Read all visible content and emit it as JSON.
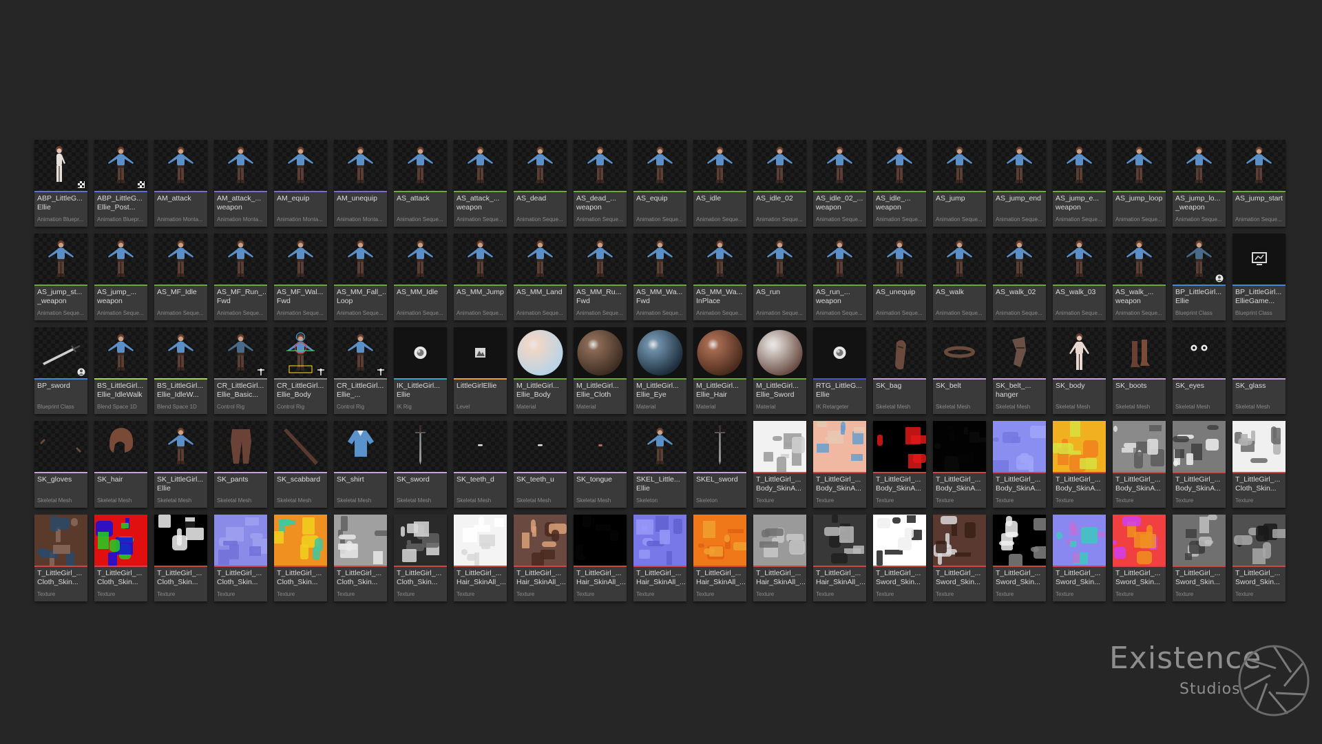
{
  "logo": {
    "main": "Existence",
    "sub": "Studios"
  },
  "colors": {
    "anim": "#5b6fd6",
    "montage": "#7f6ac9",
    "sequence": "#6fa840",
    "blueprint": "#4a86d9",
    "blendspace": "#a7d650",
    "controlrig": "#8c8c8c",
    "ikrig": "#3aa8c0",
    "level": "#e0a63a",
    "material": "#6fa840",
    "retarget": "#4a57c8",
    "mesh": "#c7a5d8",
    "skeleton": "#c7a5d8",
    "texture": "#d04646"
  },
  "assets": [
    {
      "name": "ABP_LittleG...\nEllie",
      "type": "Animation Bluepr...",
      "kind": "anim",
      "thumb": "char-pose",
      "badge": "flag-icon"
    },
    {
      "name": "ABP_LittleG...\nEllie_Post...",
      "type": "Animation Bluepr...",
      "kind": "anim",
      "thumb": "char",
      "badge": "flag-icon"
    },
    {
      "name": "AM_attack",
      "type": "Animation Monta...",
      "kind": "montage",
      "thumb": "char"
    },
    {
      "name": "AM_attack_...\nweapon",
      "type": "Animation Monta...",
      "kind": "montage",
      "thumb": "char"
    },
    {
      "name": "AM_equip",
      "type": "Animation Monta...",
      "kind": "montage",
      "thumb": "char"
    },
    {
      "name": "AM_unequip",
      "type": "Animation Monta...",
      "kind": "montage",
      "thumb": "char"
    },
    {
      "name": "AS_attack",
      "type": "Animation Seque...",
      "kind": "sequence",
      "thumb": "char"
    },
    {
      "name": "AS_attack_...\nweapon",
      "type": "Animation Seque...",
      "kind": "sequence",
      "thumb": "char"
    },
    {
      "name": "AS_dead",
      "type": "Animation Seque...",
      "kind": "sequence",
      "thumb": "char"
    },
    {
      "name": "AS_dead_...\nweapon",
      "type": "Animation Seque...",
      "kind": "sequence",
      "thumb": "char"
    },
    {
      "name": "AS_equip",
      "type": "Animation Seque...",
      "kind": "sequence",
      "thumb": "char"
    },
    {
      "name": "AS_idle",
      "type": "Animation Seque...",
      "kind": "sequence",
      "thumb": "char"
    },
    {
      "name": "AS_idle_02",
      "type": "Animation Seque...",
      "kind": "sequence",
      "thumb": "char"
    },
    {
      "name": "AS_idle_02_...\nweapon",
      "type": "Animation Seque...",
      "kind": "sequence",
      "thumb": "char"
    },
    {
      "name": "AS_idle_...\nweapon",
      "type": "Animation Seque...",
      "kind": "sequence",
      "thumb": "char"
    },
    {
      "name": "AS_jump",
      "type": "Animation Seque...",
      "kind": "sequence",
      "thumb": "char"
    },
    {
      "name": "AS_jump_end",
      "type": "Animation Seque...",
      "kind": "sequence",
      "thumb": "char"
    },
    {
      "name": "AS_jump_e...\nweapon",
      "type": "Animation Seque...",
      "kind": "sequence",
      "thumb": "char"
    },
    {
      "name": "AS_jump_loop",
      "type": "Animation Seque...",
      "kind": "sequence",
      "thumb": "char"
    },
    {
      "name": "AS_jump_lo...\n_weapon",
      "type": "Animation Seque...",
      "kind": "sequence",
      "thumb": "char"
    },
    {
      "name": "AS_jump_start",
      "type": "Animation Seque...",
      "kind": "sequence",
      "thumb": "char"
    },
    {
      "name": "AS_jump_st...\n_weapon",
      "type": "Animation Seque...",
      "kind": "sequence",
      "thumb": "char"
    },
    {
      "name": "AS_jump_...\nweapon",
      "type": "Animation Seque...",
      "kind": "sequence",
      "thumb": "char"
    },
    {
      "name": "AS_MF_Idle",
      "type": "Animation Seque...",
      "kind": "sequence",
      "thumb": "char"
    },
    {
      "name": "AS_MF_Run_...\nFwd",
      "type": "Animation Seque...",
      "kind": "sequence",
      "thumb": "char"
    },
    {
      "name": "AS_MF_Wal...\nFwd",
      "type": "Animation Seque...",
      "kind": "sequence",
      "thumb": "char"
    },
    {
      "name": "AS_MM_Fall_...\nLoop",
      "type": "Animation Seque...",
      "kind": "sequence",
      "thumb": "char"
    },
    {
      "name": "AS_MM_Idle",
      "type": "Animation Seque...",
      "kind": "sequence",
      "thumb": "char"
    },
    {
      "name": "AS_MM_Jump",
      "type": "Animation Seque...",
      "kind": "sequence",
      "thumb": "char"
    },
    {
      "name": "AS_MM_Land",
      "type": "Animation Seque...",
      "kind": "sequence",
      "thumb": "char"
    },
    {
      "name": "AS_MM_Ru...\nFwd",
      "type": "Animation Seque...",
      "kind": "sequence",
      "thumb": "char"
    },
    {
      "name": "AS_MM_Wa...\nFwd",
      "type": "Animation Seque...",
      "kind": "sequence",
      "thumb": "char"
    },
    {
      "name": "AS_MM_Wa...\nInPlace",
      "type": "Animation Seque...",
      "kind": "sequence",
      "thumb": "char"
    },
    {
      "name": "AS_run",
      "type": "Animation Seque...",
      "kind": "sequence",
      "thumb": "char"
    },
    {
      "name": "AS_run_...\nweapon",
      "type": "Animation Seque...",
      "kind": "sequence",
      "thumb": "char"
    },
    {
      "name": "AS_unequip",
      "type": "Animation Seque...",
      "kind": "sequence",
      "thumb": "char"
    },
    {
      "name": "AS_walk",
      "type": "Animation Seque...",
      "kind": "sequence",
      "thumb": "char"
    },
    {
      "name": "AS_walk_02",
      "type": "Animation Seque...",
      "kind": "sequence",
      "thumb": "char"
    },
    {
      "name": "AS_walk_03",
      "type": "Animation Seque...",
      "kind": "sequence",
      "thumb": "char"
    },
    {
      "name": "AS_walk_...\nweapon",
      "type": "Animation Seque...",
      "kind": "sequence",
      "thumb": "char"
    },
    {
      "name": "BP_LittleGirl...\nEllie",
      "type": "Blueprint Class",
      "kind": "blueprint",
      "thumb": "char-dark",
      "badge": "person-icon"
    },
    {
      "name": "BP_LittleGirl...\nEllieGame...",
      "type": "Blueprint Class",
      "kind": "blueprint",
      "thumb": "monitor-icon"
    },
    {
      "name": "BP_sword",
      "type": "Blueprint Class",
      "kind": "blueprint",
      "thumb": "sword-diag",
      "badge": "person-icon"
    },
    {
      "name": "BS_LittleGirl...\nEllie_IdleWalk",
      "type": "Blend Space 1D",
      "kind": "blendspace",
      "thumb": "char"
    },
    {
      "name": "BS_LittleGirl...\nEllie_IdleW...",
      "type": "Blend Space 1D",
      "kind": "blendspace",
      "thumb": "char"
    },
    {
      "name": "CR_LittleGirl...\nEllie_Basic...",
      "type": "Control Rig",
      "kind": "controlrig",
      "thumb": "char-dark",
      "badge": "rig-icon"
    },
    {
      "name": "CR_LittleGirl...\nEllie_Body",
      "type": "Control Rig",
      "kind": "controlrig",
      "thumb": "char-rig",
      "badge": "rig-icon"
    },
    {
      "name": "CR_LittleGirl...\nEllie_...",
      "type": "Control Rig",
      "kind": "controlrig",
      "thumb": "char",
      "badge": "rig-icon"
    },
    {
      "name": "IK_LittleGirl...\nEllie",
      "type": "IK Rig",
      "kind": "ikrig",
      "thumb": "rig-sphere-icon"
    },
    {
      "name": "LittleGirlEllie",
      "type": "Level",
      "kind": "level",
      "thumb": "level-icon"
    },
    {
      "name": "M_LittleGirl...\nEllie_Body",
      "type": "Material",
      "kind": "material",
      "thumb": "sphere:#efd6c8:#b8d4e6"
    },
    {
      "name": "M_LittleGirl...\nEllie_Cloth",
      "type": "Material",
      "kind": "material",
      "thumb": "sphere:#8a6a55:#3d2c22"
    },
    {
      "name": "M_LittleGirl...\nEllie_Eye",
      "type": "Material",
      "kind": "material",
      "thumb": "sphere:#6f8fa8:#1c2d3c"
    },
    {
      "name": "M_LittleGirl...\nEllie_Hair",
      "type": "Material",
      "kind": "material",
      "thumb": "sphere:#a56a50:#4a2a1c"
    },
    {
      "name": "M_LittleGirl...\nEllie_Sword",
      "type": "Material",
      "kind": "material",
      "thumb": "sphere:#d8d0cc:#6a4d44"
    },
    {
      "name": "RTG_LittleG...\nEllie",
      "type": "IK Retargeter",
      "kind": "retarget",
      "thumb": "rig-sphere-icon"
    },
    {
      "name": "SK_bag",
      "type": "Skeletal Mesh",
      "kind": "mesh",
      "thumb": "bag"
    },
    {
      "name": "SK_belt",
      "type": "Skeletal Mesh",
      "kind": "mesh",
      "thumb": "belt"
    },
    {
      "name": "SK_belt_...\nhanger",
      "type": "Skeletal Mesh",
      "kind": "mesh",
      "thumb": "hanger"
    },
    {
      "name": "SK_body",
      "type": "Skeletal Mesh",
      "kind": "mesh",
      "thumb": "body"
    },
    {
      "name": "SK_boots",
      "type": "Skeletal Mesh",
      "kind": "mesh",
      "thumb": "boots"
    },
    {
      "name": "SK_eyes",
      "type": "Skeletal Mesh",
      "kind": "mesh",
      "thumb": "eyes"
    },
    {
      "name": "SK_glass",
      "type": "Skeletal Mesh",
      "kind": "mesh",
      "thumb": "empty"
    },
    {
      "name": "SK_gloves",
      "type": "Skeletal Mesh",
      "kind": "mesh",
      "thumb": "gloves"
    },
    {
      "name": "SK_hair",
      "type": "Skeletal Mesh",
      "kind": "mesh",
      "thumb": "hair"
    },
    {
      "name": "SK_LittleGirl...\nEllie",
      "type": "Skeletal Mesh",
      "kind": "mesh",
      "thumb": "char"
    },
    {
      "name": "SK_pants",
      "type": "Skeletal Mesh",
      "kind": "mesh",
      "thumb": "pants"
    },
    {
      "name": "SK_scabbard",
      "type": "Skeletal Mesh",
      "kind": "mesh",
      "thumb": "scabbard"
    },
    {
      "name": "SK_shirt",
      "type": "Skeletal Mesh",
      "kind": "mesh",
      "thumb": "shirt"
    },
    {
      "name": "SK_sword",
      "type": "Skeletal Mesh",
      "kind": "mesh",
      "thumb": "sword-v"
    },
    {
      "name": "SK_teeth_d",
      "type": "Skeletal Mesh",
      "kind": "mesh",
      "thumb": "teeth"
    },
    {
      "name": "SK_teeth_u",
      "type": "Skeletal Mesh",
      "kind": "mesh",
      "thumb": "teeth"
    },
    {
      "name": "SK_tongue",
      "type": "Skeletal Mesh",
      "kind": "mesh",
      "thumb": "tongue"
    },
    {
      "name": "SKEL_Little...\nEllie",
      "type": "Skeleton",
      "kind": "skeleton",
      "thumb": "char"
    },
    {
      "name": "SKEL_sword",
      "type": "Skeleton",
      "kind": "skeleton",
      "thumb": "sword-v"
    },
    {
      "name": "T_LittleGirl_...\nBody_SkinA...",
      "type": "Texture",
      "kind": "texture",
      "thumb": "tex:#f2f2f2:#9a9a9a:#d0d0d0"
    },
    {
      "name": "T_LittleGirl_...\nBody_SkinA...",
      "type": "Texture",
      "kind": "texture",
      "thumb": "tex:#f0b8a0:#6a9ccc:#e8c8b4"
    },
    {
      "name": "T_LittleGirl_...\nBody_SkinA...",
      "type": "Texture",
      "kind": "texture",
      "thumb": "tex:#000000:#e01818:#000000"
    },
    {
      "name": "T_LittleGirl_...\nBody_SkinA...",
      "type": "Texture",
      "kind": "texture",
      "thumb": "tex:#020202:#0a0a0a:#050505"
    },
    {
      "name": "T_LittleGirl_...\nBody_SkinA...",
      "type": "Texture",
      "kind": "texture",
      "thumb": "tex:#8a8ef0:#7478e0:#a0a4f8"
    },
    {
      "name": "T_LittleGirl_...\nBody_SkinA...",
      "type": "Texture",
      "kind": "texture",
      "thumb": "tex:#f0b020:#d8e040:#f08020"
    },
    {
      "name": "T_LittleGirl_...\nBody_SkinA...",
      "type": "Texture",
      "kind": "texture",
      "thumb": "tex:#8a8a8a:#e0e0e0:#5a5a5a"
    },
    {
      "name": "T_LittleGirl_...\nBody_SkinA...",
      "type": "Texture",
      "kind": "texture",
      "thumb": "tex:#7a7a7a:#f0f0f0:#404040"
    },
    {
      "name": "T_LittleGirl_...\nCloth_Skin...",
      "type": "Texture",
      "kind": "texture",
      "thumb": "tex:#f0f0f0:#6a6a6a:#b0b0b0"
    },
    {
      "name": "T_LittleGirl_...\nCloth_Skin...",
      "type": "Texture",
      "kind": "texture",
      "thumb": "tex:#5a3a2a:#2a4a6a:#8a6a5a"
    },
    {
      "name": "T_LittleGirl_...\nCloth_Skin...",
      "type": "Texture",
      "kind": "texture",
      "thumb": "tex:#e01010:#20d020:#1010e0"
    },
    {
      "name": "T_LittleGirl_...\nCloth_Skin...",
      "type": "Texture",
      "kind": "texture",
      "thumb": "tex:#000000:#f0f0f0:#000000"
    },
    {
      "name": "T_LittleGirl_...\nCloth_Skin...",
      "type": "Texture",
      "kind": "texture",
      "thumb": "tex:#8a8ae8:#a0a0f0:#7070d8"
    },
    {
      "name": "T_LittleGirl_...\nCloth_Skin...",
      "type": "Texture",
      "kind": "texture",
      "thumb": "tex:#f09020:#40c8a0:#f0d020"
    },
    {
      "name": "T_LittleGirl_...\nCloth_Skin...",
      "type": "Texture",
      "kind": "texture",
      "thumb": "tex:#a0a0a0:#e8e8e8:#606060"
    },
    {
      "name": "T_LittleGirl_...\nCloth_Skin...",
      "type": "Texture",
      "kind": "texture",
      "thumb": "tex:#2a2a2a:#d8d8d8:#606060"
    },
    {
      "name": "T_LittleGirl_...\nHair_SkinAll_...",
      "type": "Texture",
      "kind": "texture",
      "thumb": "tex:#f4f4f4:#d8d8d8:#ffffff"
    },
    {
      "name": "T_LittleGirl_...\nHair_SkinAll_...",
      "type": "Texture",
      "kind": "texture",
      "thumb": "tex:#6a4a40:#d8a078:#4a2a20"
    },
    {
      "name": "T_LittleGirl_...\nHair_SkinAll_...",
      "type": "Texture",
      "kind": "texture",
      "thumb": "tex:#000000:#050505:#000000"
    },
    {
      "name": "T_LittleGirl_...\nHair_SkinAll_...",
      "type": "Texture",
      "kind": "texture",
      "thumb": "tex:#7878e8:#9898f8:#6060d0"
    },
    {
      "name": "T_LittleGirl_...\nHair_SkinAll_...",
      "type": "Texture",
      "kind": "texture",
      "thumb": "tex:#f07818:#f0a030:#e06010"
    },
    {
      "name": "T_LittleGirl_...\nHair_SkinAll_...",
      "type": "Texture",
      "kind": "texture",
      "thumb": "tex:#9a9a9a:#c8c8c8:#707070"
    },
    {
      "name": "T_LittleGirl_...\nHair_SkinAll_...",
      "type": "Texture",
      "kind": "texture",
      "thumb": "tex:#383838:#b8b8b8:#202020"
    },
    {
      "name": "T_LittleGirl_...\nSword_Skin...",
      "type": "Texture",
      "kind": "texture",
      "thumb": "tex:#ffffff:#202020:#f0f0f0"
    },
    {
      "name": "T_LittleGirl_...\nSword_Skin...",
      "type": "Texture",
      "kind": "texture",
      "thumb": "tex:#5a3a30:#d8d8d8:#3a2018"
    },
    {
      "name": "T_LittleGirl_...\nSword_Skin...",
      "type": "Texture",
      "kind": "texture",
      "thumb": "tex:#000000:#f0f0f0:#808080"
    },
    {
      "name": "T_LittleGirl_...\nSword_Skin...",
      "type": "Texture",
      "kind": "texture",
      "thumb": "tex:#8888f0:#c070d8:#40c8c0"
    },
    {
      "name": "T_LittleGirl_...\nSword_Skin...",
      "type": "Texture",
      "kind": "texture",
      "thumb": "tex:#f04040:#f09020:#d040f0"
    },
    {
      "name": "T_LittleGirl_...\nSword_Skin...",
      "type": "Texture",
      "kind": "texture",
      "thumb": "tex:#707070:#c0c0c0:#404040"
    },
    {
      "name": "T_LittleGirl_...\nSword_Skin...",
      "type": "Texture",
      "kind": "texture",
      "thumb": "tex:#505050:#a8a8a8:#1a1a1a"
    }
  ]
}
